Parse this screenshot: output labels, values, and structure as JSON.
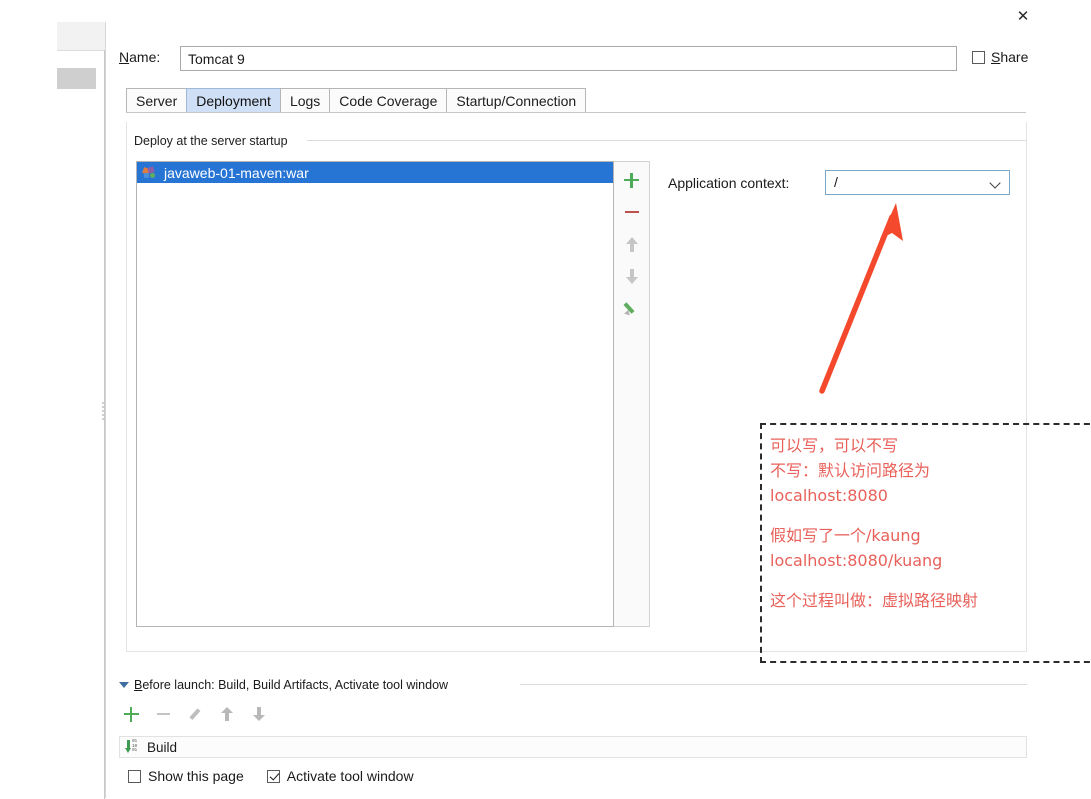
{
  "window": {
    "close_icon": "close-icon"
  },
  "sidebar": {
    "selected_item_label": ""
  },
  "name_row": {
    "label_accel": "N",
    "label_rest": "ame:",
    "value": "Tomcat 9",
    "placeholder": "",
    "share_label_accel": "S",
    "share_label_rest": "hare",
    "share_checked": false
  },
  "tabs": [
    {
      "label": "Server",
      "active": false
    },
    {
      "label": "Deployment",
      "active": true
    },
    {
      "label": "Logs",
      "active": false
    },
    {
      "label": "Code Coverage",
      "active": false
    },
    {
      "label": "Startup/Connection",
      "active": false
    }
  ],
  "deploy": {
    "group_title": "Deploy at the server startup",
    "list_items": [
      {
        "label": "javaweb-01-maven:war",
        "icon": "artifact-war-icon",
        "selected": true
      }
    ],
    "toolbar": [
      {
        "name": "add-button",
        "glyph": "plus"
      },
      {
        "name": "remove-button",
        "glyph": "minus"
      },
      {
        "name": "move-up-button",
        "glyph": "up"
      },
      {
        "name": "move-down-button",
        "glyph": "down"
      },
      {
        "name": "edit-button",
        "glyph": "pencil"
      }
    ]
  },
  "app_context": {
    "label": "Application context:",
    "value": "/",
    "chevron": "chevron-down-icon"
  },
  "annotation": {
    "arrow_color": "#f4492d",
    "text_color": "#e8615a",
    "lines": [
      "可以写，可以不写",
      "不写：默认访问路径为",
      "localhost:8080",
      "",
      "假如写了一个/kaung",
      "localhost:8080/kuang",
      "",
      "这个过程叫做：虚拟路径映射"
    ]
  },
  "before_launch": {
    "label_accel": "B",
    "label_rest": "efore launch: Build, Build Artifacts, Activate tool window",
    "toolbar": [
      {
        "name": "add-task-button",
        "glyph": "plus"
      },
      {
        "name": "remove-task-button",
        "glyph": "minus"
      },
      {
        "name": "edit-task-button",
        "glyph": "pencil"
      },
      {
        "name": "task-move-up-button",
        "glyph": "up"
      },
      {
        "name": "task-move-down-button",
        "glyph": "down"
      }
    ],
    "task_row": {
      "label": "Build",
      "icon": "build-icon",
      "icon_bits": "01\n10\n01"
    },
    "options": [
      {
        "label": "Show this page",
        "checked": false
      },
      {
        "label": "Activate tool window",
        "checked": true
      }
    ]
  },
  "colors": {
    "selection_blue": "#2675d5",
    "tab_active_blue": "#cfdff5",
    "accent_green": "#4eab57",
    "annotation_red": "#e8615a",
    "arrow_red": "#f4492d"
  }
}
